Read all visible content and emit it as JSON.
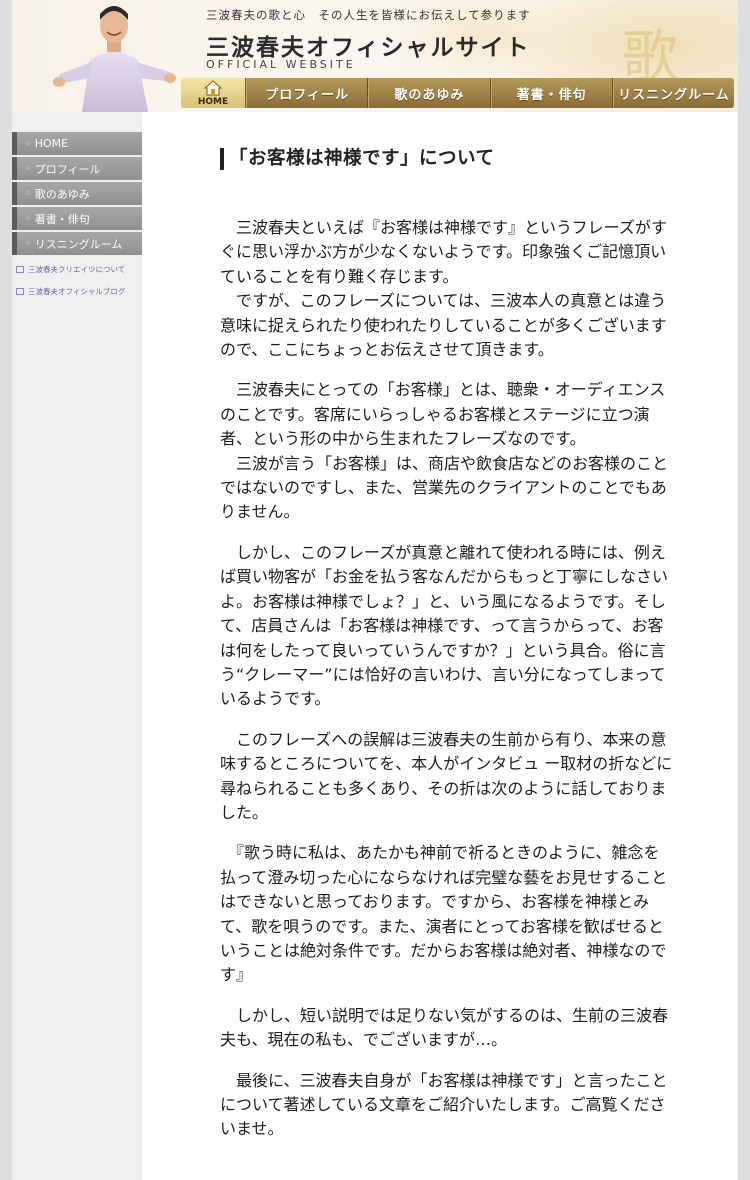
{
  "header": {
    "tagline": "三波春夫の歌と心　その人生を皆様にお伝えして参ります",
    "site_title": "三波春夫オフィシャルサイト",
    "site_subtitle": "OFFICIAL WEBSITE"
  },
  "topnav": {
    "home_label": "HOME",
    "items": [
      "プロフィール",
      "歌のあゆみ",
      "著書・俳句",
      "リスニングルーム"
    ]
  },
  "sidebar": {
    "items": [
      "HOME",
      "プロフィール",
      "歌のあゆみ",
      "著書・俳句",
      "リスニングルーム"
    ],
    "links": [
      "三波春夫クリエイツについて",
      "三波春夫オフィシャルブログ"
    ]
  },
  "main": {
    "title": "「お客様は神様です」について",
    "paragraphs": [
      "　三波春夫といえば『お客様は神様です』というフレーズがすぐに思い浮かぶ方が少なくないようです。印象強くご記憶頂いていることを有り難く存じます。",
      "　ですが、このフレーズについては、三波本人の真意とは違う意味に捉えられたり使われたりしていることが多くございますので、ここにちょっとお伝えさせて頂きます。",
      "　三波春夫にとっての「お客様」とは、聴衆・オーディエンスのことです。客席にいらっしゃるお客様とステージに立つ演者、という形の中から生まれたフレーズなのです。",
      "　三波が言う「お客様」は、商店や飲食店などのお客様のことではないのですし、また、営業先のクライアントのことでもありません。",
      "　しかし、このフレーズが真意と離れて使われる時には、例えば買い物客が「お金を払う客なんだからもっと丁寧にしなさいよ。お客様は神様でしょ？」と、いう風になるようです。そして、店員さんは「お客様は神様です、って言うからって、お客は何をしたって良いっていうんですか？」という具合。俗に言う“クレーマー”には恰好の言いわけ、言い分になってしまっているようです。",
      "　このフレーズへの誤解は三波春夫の生前から有り、本来の意味するところについてを、本人がインタビュ ー取材の折などに尋ねられることも多くあり、その折は次のように話しておりました。",
      "　『歌う時に私は、あたかも神前で祈るときのように、雑念を払って澄み切った心にならなければ完璧な藝をお見せすることはできないと思っております。ですから、お客様を神様とみて、歌を唄うのです。また、演者にとってお客様を歓ばせるということは絶対条件です。だからお客様は絶対者、神様なのです』",
      "　しかし、短い説明では足りない気がするのは、生前の三波春夫も、現在の私も、でございますが…。",
      "　最後に、三波春夫自身が「お客様は神様です」と言ったことについて著述している文章をご紹介いたします。ご高覧くださいませ。"
    ]
  }
}
